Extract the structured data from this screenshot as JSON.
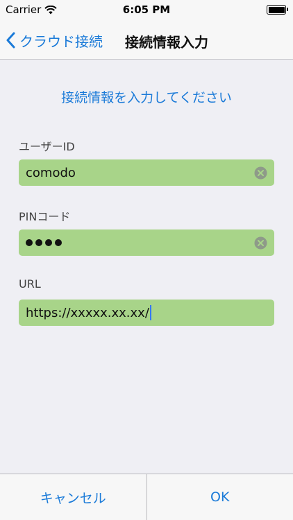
{
  "status_bar": {
    "carrier": "Carrier",
    "time": "6:05 PM"
  },
  "nav": {
    "back_label": "クラウド接続",
    "title": "接続情報入力"
  },
  "form": {
    "instruction": "接続情報を入力してください",
    "user_id": {
      "label": "ユーザーID",
      "value": "comodo"
    },
    "pin": {
      "label": "PINコード",
      "masked_length": 4
    },
    "url": {
      "label": "URL",
      "value": "https://xxxxx.xx.xx/"
    }
  },
  "actions": {
    "cancel_label": "キャンセル",
    "ok_label": "OK"
  },
  "colors": {
    "accent": "#1a7ad8",
    "field_bg": "#a8d489",
    "background": "#efeff4"
  }
}
